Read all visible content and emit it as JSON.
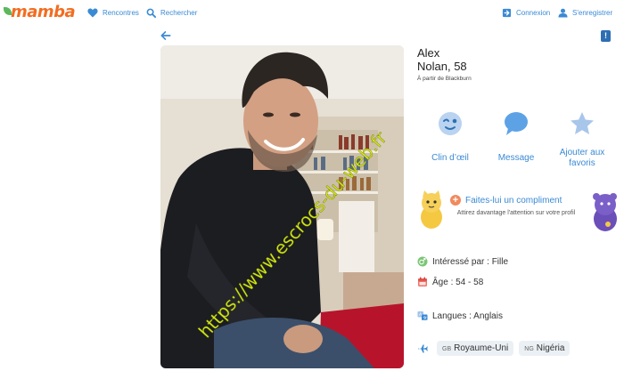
{
  "header": {
    "logo_text": "mamba",
    "nav_left": [
      {
        "label": "Rencontres",
        "icon": "heart-icon"
      },
      {
        "label": "Rechercher",
        "icon": "search-icon"
      }
    ],
    "nav_right": [
      {
        "label": "Connexion",
        "icon": "login-icon"
      },
      {
        "label": "S'enregistrer",
        "icon": "user-icon"
      }
    ]
  },
  "profile": {
    "first_name": "Alex",
    "last_name_age": "Nolan, 58",
    "location": "À partir de Blackburn",
    "watermark": "https://www.escrocs-du-web.fr"
  },
  "actions": [
    {
      "label": "Clin d’œil",
      "icon": "wink-icon"
    },
    {
      "label": "Message",
      "icon": "message-icon"
    },
    {
      "label": "Ajouter aux favoris",
      "icon": "star-icon"
    }
  ],
  "compliment": {
    "title": "Faites-lui un compliment",
    "subtitle": "Attirez davantage l'attention sur votre profil"
  },
  "details": {
    "interest": "Intéressé par : Fille",
    "age": "Âge : 54 - 58",
    "languages": "Langues : Anglais"
  },
  "countries": [
    {
      "code": "GB",
      "name": "Royaume-Uni"
    },
    {
      "code": "NG",
      "name": "Nigéria"
    }
  ],
  "colors": {
    "accent": "#3a8ad4",
    "brand": "#f26d21",
    "chip_bg": "#ebf0f5"
  }
}
